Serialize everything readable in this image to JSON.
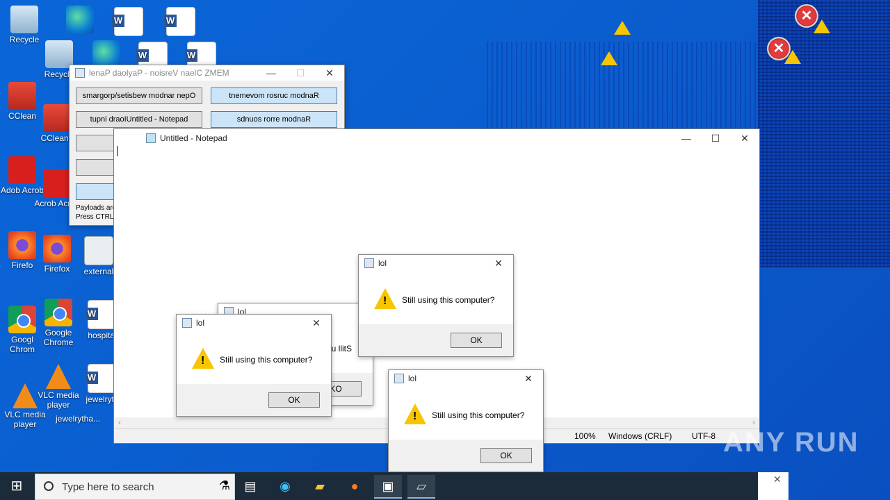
{
  "desktop": {
    "icons": [
      {
        "label": "Recycle",
        "icon": "recycle-bin-icon"
      },
      {
        "label": "Recycle",
        "icon": "recycle-bin-icon"
      },
      {
        "label": "CClean",
        "icon": "ccleaner-icon"
      },
      {
        "label": "CCleane",
        "icon": "ccleaner-icon"
      },
      {
        "label": "Adob Acrob",
        "icon": "acrobat-icon"
      },
      {
        "label": "Acrob Acrob",
        "icon": "acrobat-icon"
      },
      {
        "label": "Firefo",
        "icon": "firefox-icon"
      },
      {
        "label": "Firefox",
        "icon": "firefox-icon"
      },
      {
        "label": "external",
        "icon": "image-file-icon"
      },
      {
        "label": "Googl Chrom",
        "icon": "chrome-icon"
      },
      {
        "label": "Google Chrome",
        "icon": "chrome-icon"
      },
      {
        "label": "hospital",
        "icon": "word-doc-icon"
      },
      {
        "label": "VLC media player",
        "icon": "vlc-icon"
      },
      {
        "label": "VLC media player",
        "icon": "vlc-icon"
      },
      {
        "label": "jewelrytha...",
        "icon": "word-doc-icon"
      },
      {
        "label": "jewelryth",
        "icon": "word-doc-icon"
      }
    ]
  },
  "memz": {
    "title": "MEMZ Clean Version - Payload Panel",
    "title_mirrored": "lenaP daolyaP - noisreV naelC ZMEM",
    "buttons": [
      "smargorp/setisbew modnar nepO",
      "tnemevom rosruc modnaR",
      "tupni draoIUntitled - Notepad",
      "sdnuos rorre modnaR"
    ],
    "info_line1": "Payloads are",
    "info_line2": "Press CTRL+"
  },
  "notepad": {
    "title": "Untitled - Notepad",
    "status": {
      "zoom": "100%",
      "eol": "Windows (CRLF)",
      "encoding": "UTF-8"
    }
  },
  "dialogs": [
    {
      "title": "lol",
      "message": "Still using this computer?",
      "ok": "OK"
    },
    {
      "title": "lol",
      "message": "Still using this computer?",
      "ok": "OK"
    },
    {
      "title": "lol",
      "message": "Still using this computer?",
      "ok": "OK"
    },
    {
      "title": "lol",
      "message": "Still using this computer?",
      "ok": "OK"
    }
  ],
  "mirrored_dialog": {
    "title": "lol",
    "partial_text": "u llitS",
    "ok": "KO"
  },
  "taskbar": {
    "search_placeholder": "Type here to search",
    "apps": [
      "task-view-icon",
      "edge-icon",
      "file-explorer-icon",
      "firefox-icon",
      "memz-icon",
      "notepad-icon"
    ]
  },
  "watermark": "ANY RUN"
}
